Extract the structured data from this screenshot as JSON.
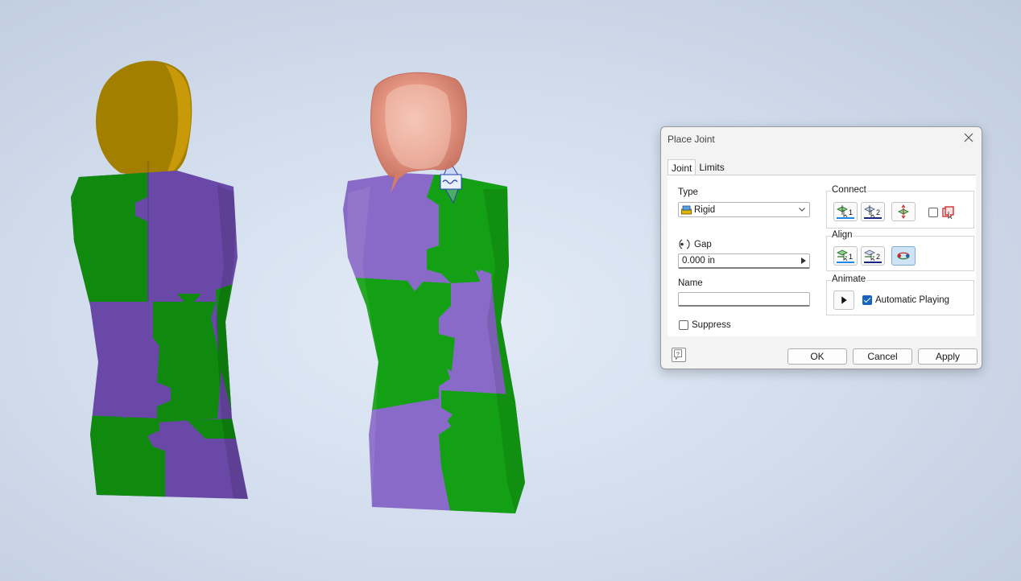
{
  "viewport": {
    "colors": {
      "green": "#0f8a0f",
      "purple": "#6a48a8",
      "gold": "#a37f00",
      "skin": "#e0907a"
    }
  },
  "dialog": {
    "title": "Place Joint",
    "tabs": [
      "Joint",
      "Limits"
    ],
    "type_label": "Type",
    "type_value": "Rigid",
    "gap_label": "Gap",
    "gap_value": "0.000 in",
    "name_label": "Name",
    "name_value": "",
    "suppress_label": "Suppress",
    "suppress_checked": false,
    "connect": {
      "title": "Connect",
      "btn1": "1",
      "btn2": "2"
    },
    "align": {
      "title": "Align",
      "btn1": "1",
      "btn2": "2"
    },
    "animate": {
      "title": "Animate",
      "auto_label": "Automatic Playing",
      "auto_checked": true
    },
    "buttons": {
      "ok": "OK",
      "cancel": "Cancel",
      "apply": "Apply"
    }
  }
}
